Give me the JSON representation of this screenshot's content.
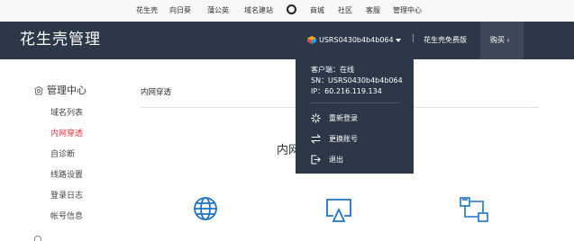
{
  "top_nav": {
    "links": [
      "花生壳",
      "向日葵",
      "蒲公英",
      "域名建站",
      "商城",
      "社区",
      "客服",
      "管理中心"
    ]
  },
  "header": {
    "brand": "花生壳管理",
    "account": "USRS0430b4b4b064",
    "divider": "|",
    "free_version": "花生壳免费版",
    "buy": "购买 ›"
  },
  "sidebar": {
    "title": "管理中心",
    "items": [
      {
        "label": "域名列表",
        "active": false
      },
      {
        "label": "内网穿透",
        "active": true
      },
      {
        "label": "自诊断",
        "active": false
      },
      {
        "label": "线路设置",
        "active": false
      },
      {
        "label": "登录日志",
        "active": false
      },
      {
        "label": "帐号信息",
        "active": false
      }
    ]
  },
  "main": {
    "breadcrumb": "内网穿透",
    "heading": "内网"
  },
  "dropdown": {
    "status": "客户端：在线",
    "sn": "SN：USRS0430b4b4b064",
    "ip": "IP：60.216.119.134",
    "menu": [
      {
        "label": "重新登录",
        "icon": "loading-spinner-icon"
      },
      {
        "label": "更换账号",
        "icon": "swap-arrows-icon"
      },
      {
        "label": "退出",
        "icon": "logout-icon"
      }
    ]
  },
  "colors": {
    "header_bg": "#2c3848",
    "accent_active": "#e03a3a",
    "icon_blue": "#1e73c8"
  }
}
